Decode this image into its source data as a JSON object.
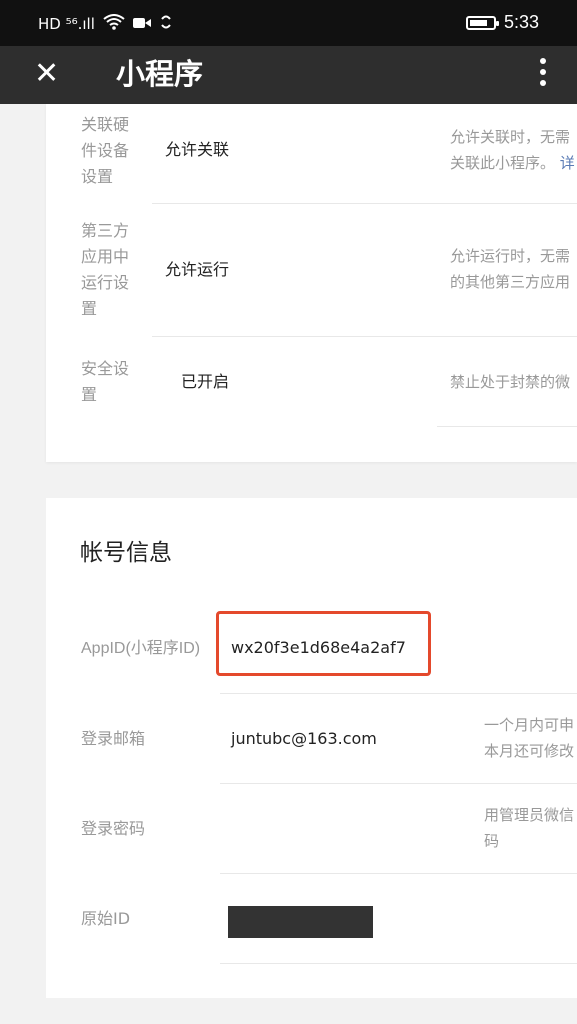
{
  "status_bar": {
    "left_indicators": "HD ⁵⁶.ıll",
    "time": "5:33"
  },
  "titlebar": {
    "close_glyph": "✕",
    "title": "小程序"
  },
  "settings_card": {
    "rows": [
      {
        "label_lines": [
          "关联硬",
          "件设备",
          "设置"
        ],
        "value": "允许关联",
        "desc_lines": [
          "允许关联时，无需",
          "关联此小程序。"
        ],
        "desc_link": "详"
      },
      {
        "label_lines": [
          "第三方",
          "应用中",
          "运行设",
          "置"
        ],
        "value": "允许运行",
        "desc_lines": [
          "允许运行时，无需",
          "的其他第三方应用"
        ]
      },
      {
        "label_lines": [
          "安全设",
          "置"
        ],
        "value": "已开启",
        "desc_lines": [
          "禁止处于封禁的微"
        ]
      }
    ]
  },
  "account_card": {
    "title": "帐号信息",
    "rows": [
      {
        "label": "AppID(小程序ID)",
        "value": "wx20f3e1d68e4a2af7"
      },
      {
        "label": "登录邮箱",
        "value": "juntubc@163.com",
        "desc_lines": [
          "一个月内可申",
          "本月还可修改"
        ]
      },
      {
        "label": "登录密码",
        "value": "",
        "desc_lines": [
          "用管理员微信",
          "码"
        ]
      },
      {
        "label": "原始ID",
        "value": ""
      }
    ]
  },
  "colors": {
    "highlight_border": "#e4492c",
    "link": "#5a7bb5",
    "titlebar": "#2e2e2e"
  }
}
